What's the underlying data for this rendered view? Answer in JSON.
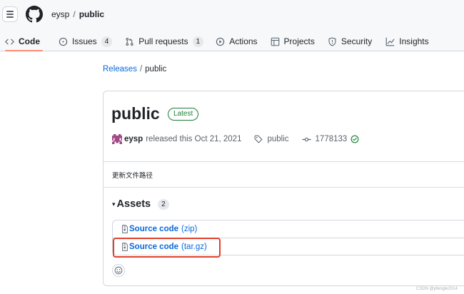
{
  "header": {
    "owner": "eysp",
    "separator": "/",
    "repo": "public"
  },
  "tabs": [
    {
      "label": "Code",
      "icon": "code-icon",
      "active": true
    },
    {
      "label": "Issues",
      "icon": "issue-icon",
      "count": "4"
    },
    {
      "label": "Pull requests",
      "icon": "pull-request-icon",
      "count": "1"
    },
    {
      "label": "Actions",
      "icon": "play-icon"
    },
    {
      "label": "Projects",
      "icon": "table-icon"
    },
    {
      "label": "Security",
      "icon": "shield-icon"
    },
    {
      "label": "Insights",
      "icon": "graph-icon"
    }
  ],
  "breadcrumb": {
    "releases": "Releases",
    "separator": "/",
    "current": "public"
  },
  "release": {
    "title": "public",
    "badge": "Latest",
    "author": "eysp",
    "released_text": "released this Oct 21, 2021",
    "tag": "public",
    "commit": "1778133",
    "notes": "更新文件路径"
  },
  "assets": {
    "heading": "Assets",
    "toggle": "▾",
    "count": "2",
    "items": [
      {
        "name": "Source code",
        "ext": "(zip)"
      },
      {
        "name": "Source code",
        "ext": "(tar.gz)"
      }
    ]
  },
  "watermark": "CSDN @pfengle2014",
  "colors": {
    "link": "#0969da",
    "success": "#1a7f37",
    "active_tab_underline": "#fd8c73",
    "highlight_box": "#e0402a"
  }
}
